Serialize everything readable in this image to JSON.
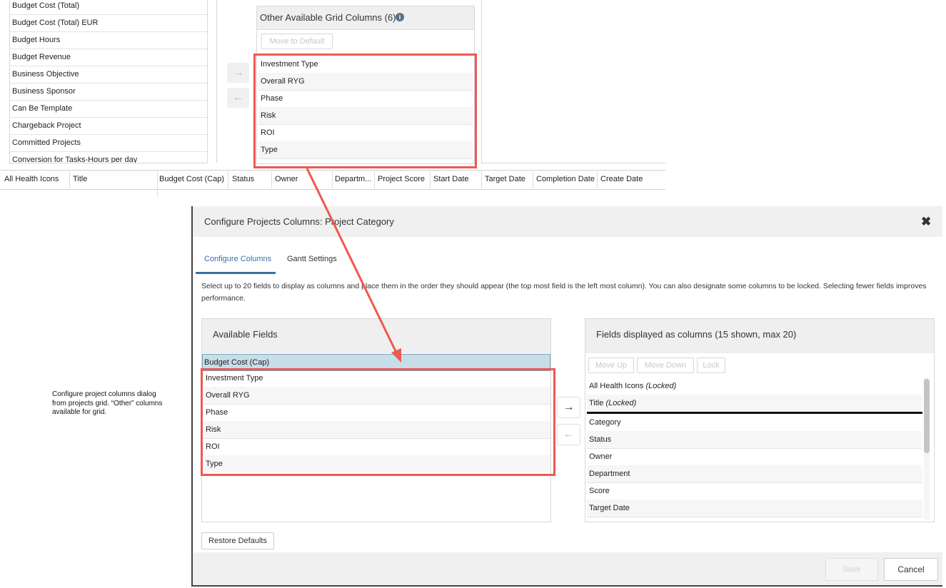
{
  "top_left_list": {
    "items": [
      "Budget Cost (Total)",
      "Budget Cost (Total) EUR",
      "Budget Hours",
      "Budget Revenue",
      "Business Objective",
      "Business Sponsor",
      "Can Be Template",
      "Chargeback Project",
      "Committed Projects",
      "Conversion for Tasks-Hours per day"
    ]
  },
  "other_panel": {
    "title": "Other Available Grid Columns (6)",
    "info_icon": "info-icon",
    "move_to_default_label": "Move to Default",
    "items": [
      "Investment Type",
      "Overall RYG",
      "Phase",
      "Risk",
      "ROI",
      "Type"
    ]
  },
  "grid_header": {
    "columns": [
      "All Health Icons",
      "Title",
      "Budget Cost (Cap)",
      "Status",
      "Owner",
      "Departm...",
      "Project Score",
      "Start Date",
      "Target Date",
      "Completion Date",
      "Create Date"
    ]
  },
  "caption": {
    "line1": "Configure project columns dialog",
    "line2": "from projects grid. “Other” columns",
    "line3": "available for grid."
  },
  "dialog": {
    "title": "Configure Projects Columns: Project Category",
    "close_icon": "close-icon",
    "tabs": [
      {
        "label": "Configure Columns",
        "active": true
      },
      {
        "label": "Gantt Settings",
        "active": false
      }
    ],
    "description": "Select up to 20 fields to display as columns and place them in the order they should appear (the top most field is the left most column). You can also designate some columns to be locked. Selecting fewer fields improves performance.",
    "available": {
      "title": "Available Fields",
      "selected_item": "Budget Cost (Cap)",
      "items": [
        "Investment Type",
        "Overall RYG",
        "Phase",
        "Risk",
        "ROI",
        "Type"
      ]
    },
    "displayed": {
      "title": "Fields displayed as columns (15 shown, max 20)",
      "move_up_label": "Move Up",
      "move_down_label": "Move Down",
      "lock_label": "Lock",
      "locked_items": [
        {
          "label": "All Health Icons",
          "tag": "(Locked)"
        },
        {
          "label": "Title",
          "tag": "(Locked)"
        }
      ],
      "items": [
        "Category",
        "Status",
        "Owner",
        "Department",
        "Score",
        "Target Date"
      ]
    },
    "restore_defaults_label": "Restore Defaults",
    "save_label": "Save",
    "cancel_label": "Cancel"
  },
  "colors": {
    "highlight": "#f0584f",
    "accent": "#3b6fa5",
    "selected_row": "#c7dde8"
  }
}
